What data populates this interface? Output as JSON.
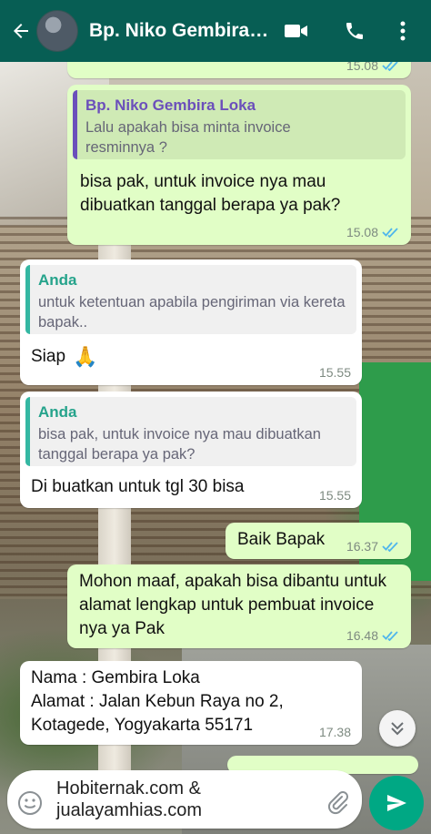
{
  "header": {
    "contact_name": "Bp. Niko Gembira Loka",
    "icons": [
      "back-arrow-icon",
      "video-call-icon",
      "voice-call-icon",
      "more-options-icon"
    ],
    "color": "#075e54"
  },
  "messages": [
    {
      "type": "outgoing",
      "time": "15.08",
      "status": "read"
    },
    {
      "type": "outgoing",
      "quote_author": "Bp. Niko Gembira Loka",
      "quote_text": "Lalu apakah bisa minta invoice resminnya ?",
      "text": "bisa pak, untuk invoice nya mau dibuatkan tanggal berapa ya pak?",
      "time": "15.08",
      "status": "read"
    },
    {
      "type": "incoming",
      "quote_author": "Anda",
      "quote_text": "untuk ketentuan apabila pengiriman via kereta bapak..",
      "text": "Siap",
      "emoji": "🙏",
      "time": "15.55"
    },
    {
      "type": "incoming",
      "quote_author": "Anda",
      "quote_text": "bisa pak, untuk invoice nya mau dibuatkan tanggal berapa ya pak?",
      "text": "Di buatkan untuk tgl 30 bisa",
      "time": "15.55"
    },
    {
      "type": "outgoing",
      "text": "Baik Bapak",
      "time": "16.37",
      "status": "read"
    },
    {
      "type": "outgoing",
      "text": "Mohon maaf, apakah bisa dibantu untuk alamat lengkap untuk pembuat invoice nya ya Pak",
      "time": "16.48",
      "status": "read"
    },
    {
      "type": "incoming",
      "text": "Nama : Gembira Loka\nAlamat : Jalan Kebun Raya no 2, Kotagede, Yogyakarta 55171",
      "time": "17.38"
    }
  ],
  "composer": {
    "text": "Hobiternak.com & jualayamhias.com",
    "icons": [
      "emoji-icon",
      "attach-icon",
      "send-icon"
    ],
    "send_color": "#00a884"
  },
  "colors": {
    "outgoing_bubble": "#e1fec6",
    "incoming_bubble": "#ffffff",
    "read_tick": "#4fb6ec"
  }
}
